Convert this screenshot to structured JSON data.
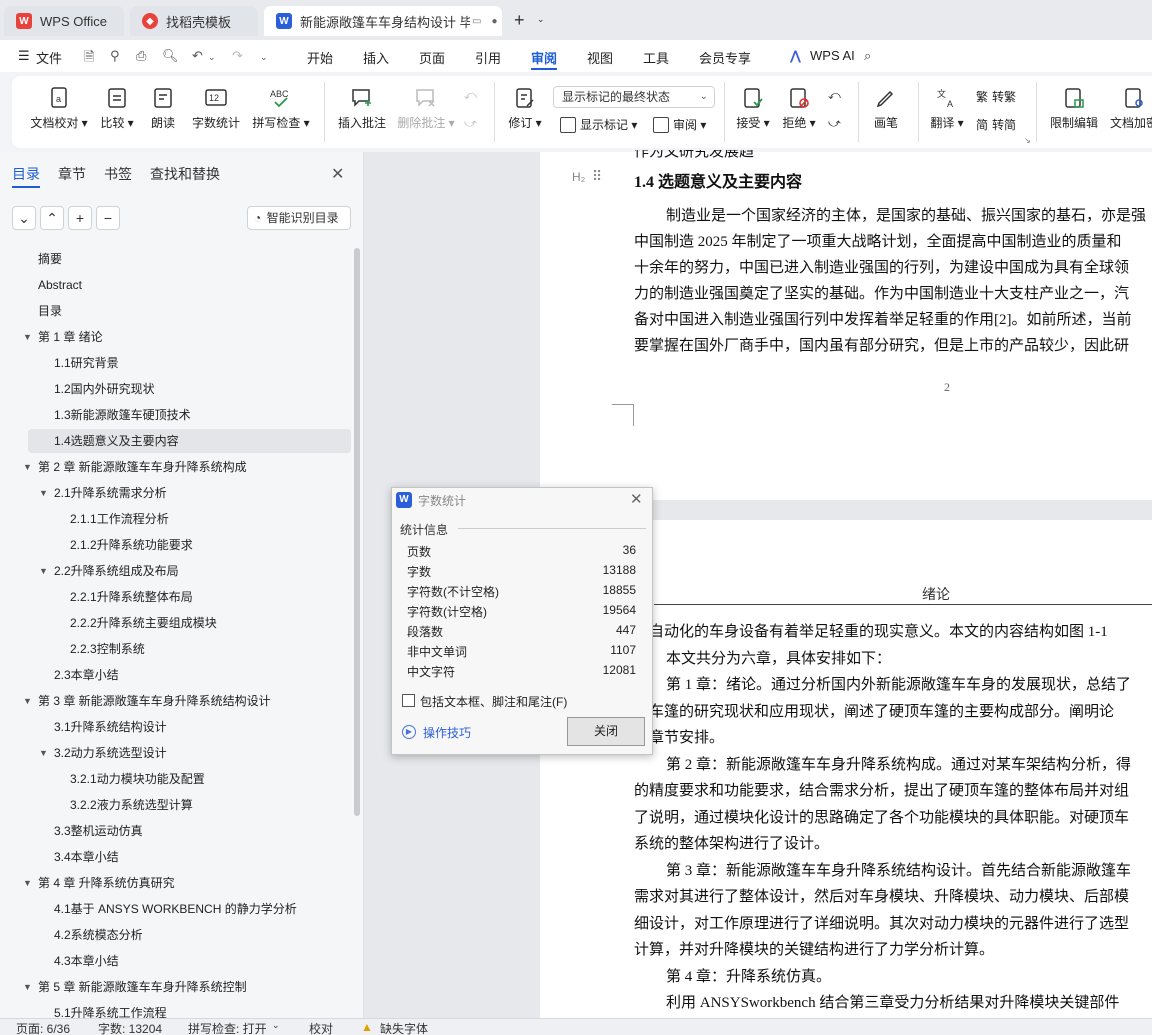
{
  "tabs": [
    {
      "label": "WPS Office",
      "icon": "wps-logo-icon"
    },
    {
      "label": "找稻壳模板",
      "icon": "docer-icon"
    },
    {
      "label": "新能源敞篷车车身结构设计 毕",
      "icon": "writer-doc-icon"
    }
  ],
  "menu": [
    "文件",
    "开始",
    "插入",
    "页面",
    "引用",
    "审阅",
    "视图",
    "工具",
    "会员专享",
    "WPS AI"
  ],
  "active_menu": "审阅",
  "ribbon": {
    "doc_check": "文档校对",
    "compare": "比较",
    "read_aloud": "朗读",
    "word_count": "字数统计",
    "spell_check": "拼写检查",
    "insert_comment": "插入批注",
    "delete_comment": "删除批注",
    "revise": "修订",
    "markup_select": "显示标记的最终状态",
    "show_markup": "显示标记",
    "review": "审阅",
    "accept": "接受",
    "reject": "拒绝",
    "pen": "画笔",
    "translate": "翻译",
    "to_traditional": "转繁",
    "to_simplified": "转简",
    "restrict_edit": "限制编辑",
    "doc_encrypt": "文档加密"
  },
  "sidebar": {
    "tabs": [
      "目录",
      "章节",
      "书签",
      "查找和替换"
    ],
    "smart_toc": "智能识别目录",
    "items": [
      {
        "label": "摘要",
        "level": 1,
        "toggle": false
      },
      {
        "label": "Abstract",
        "level": 1,
        "toggle": false
      },
      {
        "label": "目录",
        "level": 1,
        "toggle": false
      },
      {
        "label": "第 1 章 绪论",
        "level": 1,
        "toggle": true
      },
      {
        "label": "1.1研究背景",
        "level": 2,
        "toggle": false
      },
      {
        "label": "1.2国内外研究现状",
        "level": 2,
        "toggle": false
      },
      {
        "label": "1.3新能源敞篷车硬顶技术",
        "level": 2,
        "toggle": false
      },
      {
        "label": "1.4选题意义及主要内容",
        "level": 2,
        "toggle": false
      },
      {
        "label": "第 2 章 新能源敞篷车车身升降系统构成",
        "level": 1,
        "toggle": true
      },
      {
        "label": "2.1升降系统需求分析",
        "level": 2,
        "toggle": true
      },
      {
        "label": "2.1.1工作流程分析",
        "level": 3,
        "toggle": false
      },
      {
        "label": "2.1.2升降系统功能要求",
        "level": 3,
        "toggle": false
      },
      {
        "label": "2.2升降系统组成及布局",
        "level": 2,
        "toggle": true
      },
      {
        "label": "2.2.1升降系统整体布局",
        "level": 3,
        "toggle": false
      },
      {
        "label": "2.2.2升降系统主要组成模块",
        "level": 3,
        "toggle": false
      },
      {
        "label": "2.2.3控制系统",
        "level": 3,
        "toggle": false
      },
      {
        "label": "2.3本章小结",
        "level": 2,
        "toggle": false
      },
      {
        "label": "第 3 章 新能源敞篷车车身升降系统结构设计",
        "level": 1,
        "toggle": true
      },
      {
        "label": "3.1升降系统结构设计",
        "level": 2,
        "toggle": false
      },
      {
        "label": "3.2动力系统选型设计",
        "level": 2,
        "toggle": true
      },
      {
        "label": "3.2.1动力模块功能及配置",
        "level": 3,
        "toggle": false
      },
      {
        "label": "3.2.2液力系统选型计算",
        "level": 3,
        "toggle": false
      },
      {
        "label": "3.3整机运动仿真",
        "level": 2,
        "toggle": false
      },
      {
        "label": "3.4本章小结",
        "level": 2,
        "toggle": false
      },
      {
        "label": "第 4 章 升降系统仿真研究",
        "level": 1,
        "toggle": true
      },
      {
        "label": "4.1基于 ANSYS WORKBENCH 的静力学分析",
        "level": 2,
        "toggle": false
      },
      {
        "label": "4.2系统模态分析",
        "level": 2,
        "toggle": false
      },
      {
        "label": "4.3本章小结",
        "level": 2,
        "toggle": false
      },
      {
        "label": "第 5 章 新能源敞篷车车身升降系统控制",
        "level": 1,
        "toggle": true
      },
      {
        "label": "5.1升降系统工作流程",
        "level": 2,
        "toggle": false
      }
    ]
  },
  "doc": {
    "top_fragment": "作为文研究发展趋",
    "heading_marker": "H₂",
    "heading": "1.4  选题意义及主要内容",
    "para1": [
      "制造业是一个国家经济的主体，是国家的基础、振兴国家的基石，亦是强",
      "中国制造 2025 年制定了一项重大战略计划，全面提高中国制造业的质量和",
      "十余年的努力，中国已进入制造业强国的行列，为建设中国成为具有全球领",
      "力的制造业强国奠定了坚实的基础。作为中国制造业十大支柱产业之一，汽",
      "备对中国进入制造业强国行列中发挥着举足轻重的作用[2]。如前所述，当前",
      "要掌握在国外厂商手中，国内虽有部分研究，但是上市的产品较少，因此研"
    ],
    "page_number": "2",
    "header_title": "绪论",
    "para2": [
      "、自动化的车身设备有着举足轻重的现实意义。本文的内容结构如图 1-1",
      "本文共分为六章，具体安排如下：",
      "第 1 章：绪论。通过分析国内外新能源敞篷车车身的发展现状，总结了",
      "顶车篷的研究现状和应用现状，阐述了硬顶车篷的主要构成部分。阐明论",
      "和章节安排。",
      "第 2 章：新能源敞篷车车身升降系统构成。通过对某车架结构分析，得",
      "的精度要求和功能要求，结合需求分析，提出了硬顶车篷的整体布局并对组",
      "了说明，通过模块化设计的思路确定了各个功能模块的具体职能。对硬顶车",
      "系统的整体架构进行了设计。",
      "第 3 章：新能源敞篷车车身升降系统结构设计。首先结合新能源敞篷车",
      "需求对其进行了整体设计，然后对车身模块、升降模块、动力模块、后部模",
      "细设计，对工作原理进行了详细说明。其次对动力模块的元器件进行了选型",
      "计算，并对升降模块的关键结构进行了力学分析计算。",
      "第 4 章：升降系统仿真。",
      "利用 ANSYSworkbench 结合第三章受力分析结果对升降模块关键部件"
    ]
  },
  "dialog": {
    "title": "字数统计",
    "section": "统计信息",
    "rows": [
      {
        "label": "页数",
        "value": "36"
      },
      {
        "label": "字数",
        "value": "13188"
      },
      {
        "label": "字符数(不计空格)",
        "value": "18855"
      },
      {
        "label": "字符数(计空格)",
        "value": "19564"
      },
      {
        "label": "段落数",
        "value": "447"
      },
      {
        "label": "非中文单词",
        "value": "1107"
      },
      {
        "label": "中文字符",
        "value": "12081"
      }
    ],
    "checkbox_label": "包括文本框、脚注和尾注(F)",
    "tips_link": "操作技巧",
    "close_button": "关闭"
  },
  "status": {
    "page": "页面: 6/36",
    "words": "字数: 13204",
    "spell": "拼写检查: 打开",
    "proof": "校对",
    "missing_font": "缺失字体"
  },
  "colors": {
    "accent": "#1e5dd3",
    "wps_red": "#e8423c"
  }
}
